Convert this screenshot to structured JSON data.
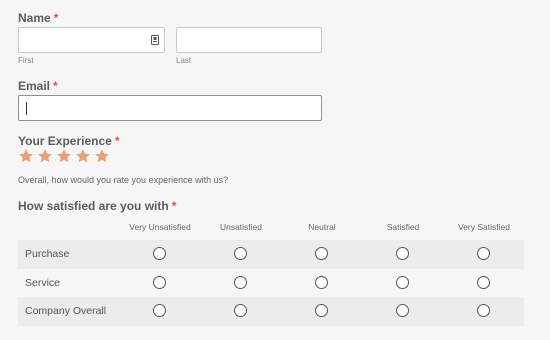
{
  "name": {
    "label": "Name",
    "required_mark": "*",
    "first_sublabel": "First",
    "last_sublabel": "Last",
    "first_value": "",
    "last_value": ""
  },
  "email": {
    "label": "Email",
    "required_mark": "*",
    "value": ""
  },
  "experience": {
    "label": "Your Experience",
    "required_mark": "*",
    "star_count": 5,
    "star_color": "#e8a07c",
    "helper": "Overall, how would you rate you experience with us?"
  },
  "satisfaction": {
    "label": "How satisfied are you with",
    "required_mark": "*",
    "columns": [
      "Very Unsatisfied",
      "Unsatisfied",
      "Neutral",
      "Satisfied",
      "Very Satisfied"
    ],
    "rows": [
      {
        "label": "Purchase"
      },
      {
        "label": "Service"
      },
      {
        "label": "Company Overall"
      }
    ]
  },
  "colors": {
    "required": "#d9534f",
    "background": "#f6f6f6",
    "row_shade": "#ececec"
  }
}
